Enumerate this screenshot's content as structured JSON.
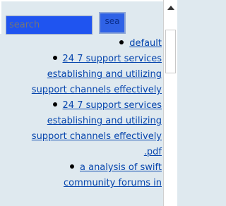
{
  "search": {
    "placeholder": "search",
    "button_label": "sea"
  },
  "results": [
    {
      "lines": [
        "default"
      ]
    },
    {
      "lines": [
        "24 7 support services",
        "establishing and utilizing",
        "support channels effectively"
      ]
    },
    {
      "lines": [
        "24 7 support services",
        "establishing and utilizing",
        "support channels effectively",
        ".pdf"
      ]
    },
    {
      "lines": [
        "a analysis of swift",
        "community forums in"
      ]
    }
  ],
  "colors": {
    "background": "#dfe9ef",
    "link": "#0645ad",
    "search_field": "#1f54f0",
    "search_button": "#2f62e6"
  }
}
